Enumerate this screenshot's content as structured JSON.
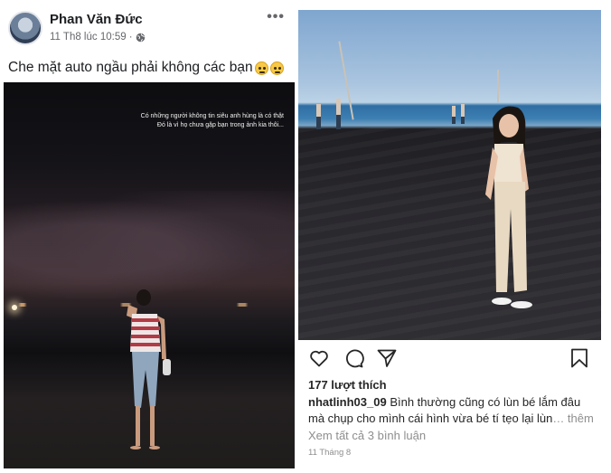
{
  "facebook_post": {
    "author_name": "Phan Văn Đức",
    "timestamp": "11 Th8 lúc 10:59 ·",
    "privacy_icon": "globe-icon",
    "more_label": "•••",
    "post_text": "Che mặt auto ngầu phải không các bạn",
    "emojis": [
      "rolling-eyes-emoji",
      "rolling-eyes-emoji"
    ],
    "photo": {
      "quote_line_1": "Có những người không tin siêu anh hùng là có thật",
      "quote_line_2": "Đó là vì họ chưa gặp bạn trong ảnh kia thôi..."
    }
  },
  "instagram_post": {
    "actions": [
      "heart-icon",
      "comment-icon",
      "share-icon",
      "bookmark-icon"
    ],
    "likes": "177 lượt thích",
    "caption_user": "nhatlinh03_09",
    "caption_line_1": " Bình thường cũng có lùn bé lắm đâu",
    "caption_line_2": "mà chụp cho mình cái hình vừa bé tí tẹo lại lùn",
    "caption_more": "… thêm",
    "view_comments": "Xem tất cả 3 bình luận",
    "date": "11 Tháng 8"
  },
  "colors": {
    "fb_text": "#1c1e21",
    "fb_secondary": "#65676b",
    "ig_text": "#262626",
    "ig_secondary": "#8e8e8e"
  }
}
